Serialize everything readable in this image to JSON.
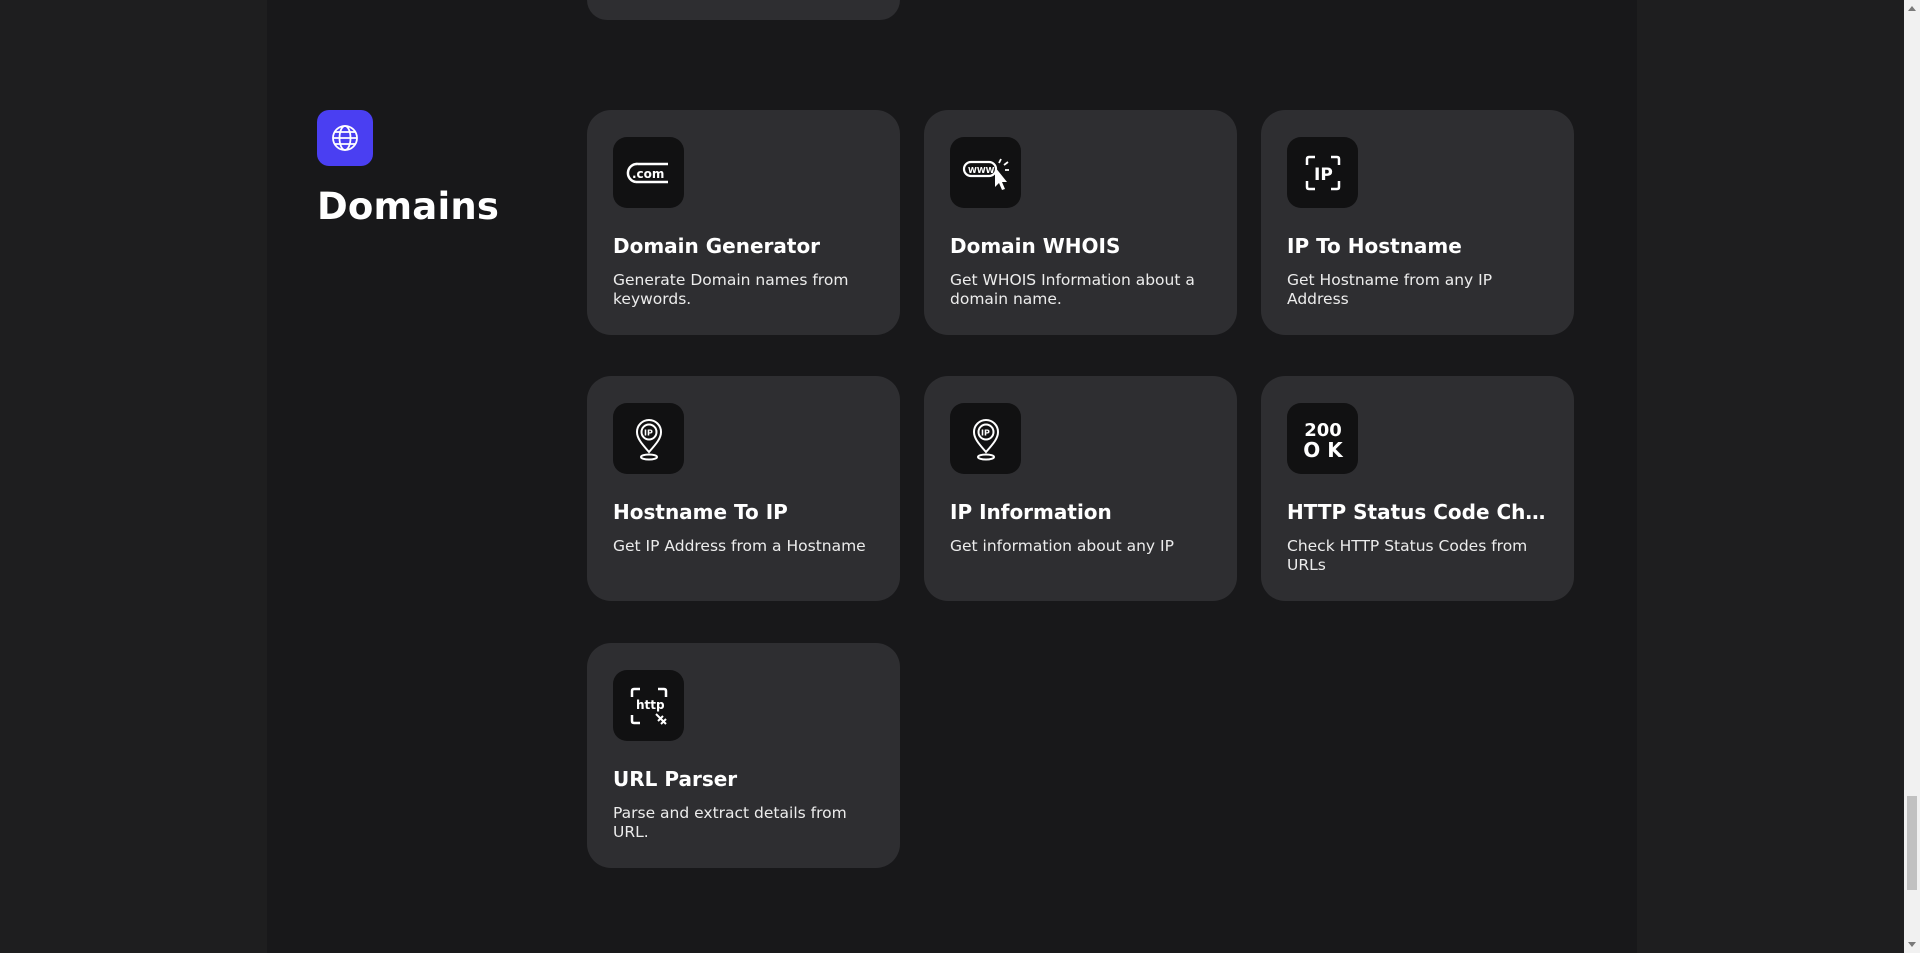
{
  "section": {
    "title": "Domains",
    "icon": "globe-icon"
  },
  "cards": [
    {
      "title": "Domain Generator",
      "desc": "Generate Domain names from keywords.",
      "icon": "dotcom-icon",
      "icon_text": ".com"
    },
    {
      "title": "Domain WHOIS",
      "desc": "Get WHOIS Information about a domain name.",
      "icon": "www-cursor-icon",
      "icon_text": "WWW"
    },
    {
      "title": "IP To Hostname",
      "desc": "Get Hostname from any IP Address",
      "icon": "ip-scan-icon",
      "icon_text": "IP"
    },
    {
      "title": "Hostname To IP",
      "desc": "Get IP Address from a Hostname",
      "icon": "ip-location-pin-icon",
      "icon_text": "IP"
    },
    {
      "title": "IP Information",
      "desc": "Get information about any IP",
      "icon": "ip-location-pin-icon",
      "icon_text": "IP"
    },
    {
      "title": "HTTP Status Code Checker",
      "desc": "Check HTTP Status Codes from URLs",
      "icon": "200-ok-icon",
      "icon_text_1": "200",
      "icon_text_2": "O K"
    },
    {
      "title": "URL Parser",
      "desc": "Parse and extract details from URL.",
      "icon": "http-scan-icon",
      "icon_text": "http"
    }
  ],
  "colors": {
    "accent": "#4a3ff2",
    "card_bg": "#2e2e31",
    "page_bg": "#18181a",
    "icon_bg": "#111112"
  }
}
